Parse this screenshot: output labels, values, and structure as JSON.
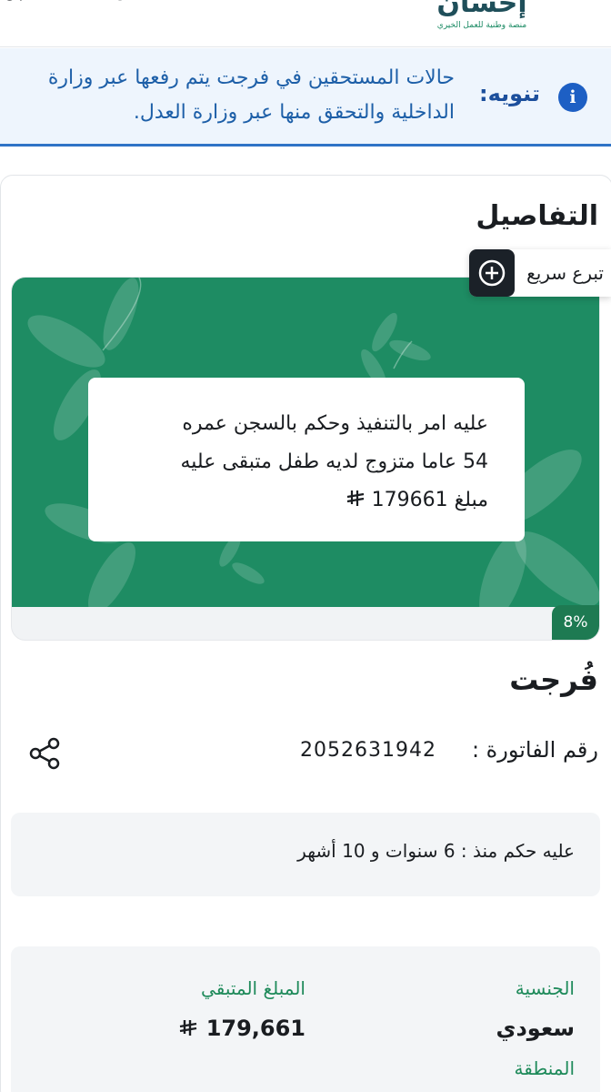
{
  "header": {
    "logo_word": "إحسان",
    "logo_tagline": "منصة وطنية للعمل الخيري",
    "icons": [
      "donations-icon",
      "cart-icon",
      "search-icon",
      "user-icon"
    ]
  },
  "notice": {
    "label": "تنويه:",
    "text": "حالات المستحقين في فرجت يتم رفعها عبر وزارة الداخلية والتحقق منها عبر وزارة العدل."
  },
  "details": {
    "title": "التفاصيل",
    "quick_donate_label": "تبرع سريع",
    "description_line1": "عليه امر بالتنفيذ وحكم بالسجن عمره",
    "description_line2": "54 عاما متزوج لديه طفل متبقى عليه",
    "description_line3": "مبلغ 179661",
    "progress_label": "8%",
    "progress_value": 8
  },
  "case": {
    "program_name": "فُرجت",
    "invoice_label": "رقم الفاتورة :",
    "invoice_number": "2052631942",
    "sentence_since": "عليه حكم منذ : 6 سنوات و 10 أشهر",
    "nationality_label": "الجنسية",
    "nationality_value": "سعودي",
    "region_label": "المنطقة",
    "remaining_label": "المبلغ المتبقي",
    "remaining_value": "179,661"
  },
  "colors": {
    "brand_green": "#1e8c63",
    "notice_blue": "#1d5fc4",
    "notice_bg": "#eef5fd",
    "label_green": "#1e8a5a"
  }
}
